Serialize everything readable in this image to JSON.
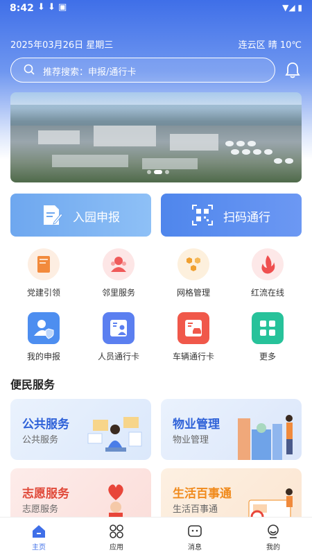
{
  "status_bar": {
    "time": "8:42",
    "notifications": "⬇ ⬇ ▣",
    "indicators": "▼◢ ▮"
  },
  "header": {
    "date": "2025年03月26日  星期三",
    "weather": "连云区 晴 10℃"
  },
  "search": {
    "placeholder": "推荐搜索：申报/通行卡"
  },
  "banner": {
    "page_count": 3,
    "active_index": 1
  },
  "primary_actions": [
    {
      "label": "入园申报",
      "icon": "document-edit-icon"
    },
    {
      "label": "扫码通行",
      "icon": "qr-code-icon"
    }
  ],
  "grid_row1": [
    {
      "label": "党建引领",
      "icon": "book-icon",
      "color": "#f28a3c"
    },
    {
      "label": "邻里服务",
      "icon": "people-icon",
      "color": "#ef5a5a"
    },
    {
      "label": "网格管理",
      "icon": "hexagon-icon",
      "color": "#f0a030"
    },
    {
      "label": "红流在线",
      "icon": "flame-icon",
      "color": "#ef4f4f"
    }
  ],
  "grid_row2": [
    {
      "label": "我的申报",
      "icon": "user-shield-icon",
      "color": "#4d8ef0"
    },
    {
      "label": "人员通行卡",
      "icon": "person-card-icon",
      "color": "#5b7ff0"
    },
    {
      "label": "车辆通行卡",
      "icon": "car-card-icon",
      "color": "#f0584a"
    },
    {
      "label": "更多",
      "icon": "more-grid-icon",
      "color": "#27c29a"
    }
  ],
  "section": {
    "title": "便民服务"
  },
  "cards": [
    {
      "title": "公共服务",
      "subtitle": "公共服务",
      "color": "#2f62d8"
    },
    {
      "title": "物业管理",
      "subtitle": "物业管理",
      "color": "#2f62d8"
    },
    {
      "title": "志愿服务",
      "subtitle": "志愿服务",
      "color": "#e04a3a"
    },
    {
      "title": "生活百事通",
      "subtitle": "生活百事通",
      "color": "#f08a1c"
    }
  ],
  "tabbar": [
    {
      "label": "主页",
      "icon": "home-icon",
      "active": true
    },
    {
      "label": "应用",
      "icon": "apps-icon",
      "active": false
    },
    {
      "label": "消息",
      "icon": "message-icon",
      "active": false
    },
    {
      "label": "我的",
      "icon": "profile-icon",
      "active": false
    }
  ],
  "colors": {
    "primary": "#3f6fe8",
    "header_gradient_end": "#dfe8fb"
  }
}
